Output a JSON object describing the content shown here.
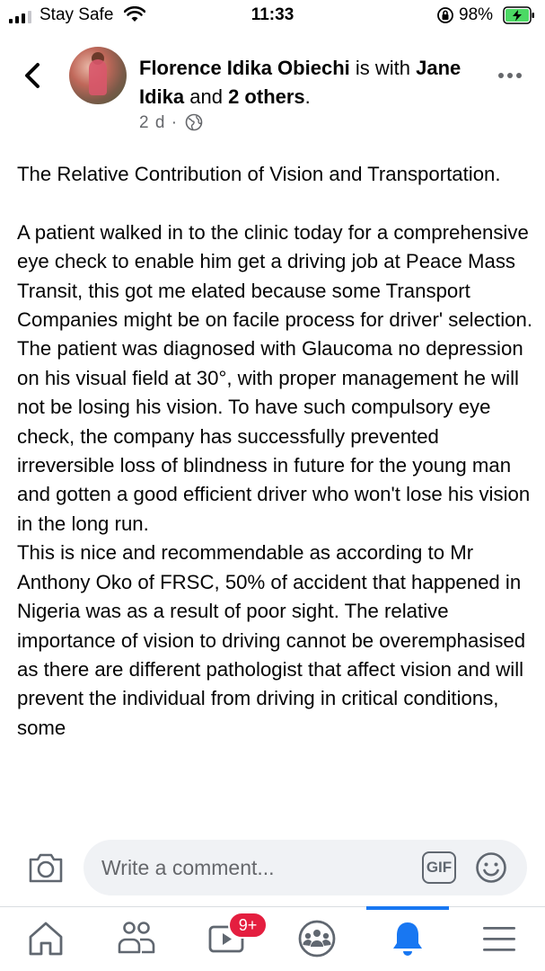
{
  "status_bar": {
    "carrier": "Stay Safe",
    "time": "11:33",
    "battery_percent": "98%"
  },
  "post": {
    "author": "Florence Idika Obiechi",
    "with_text": " is with ",
    "tagged_person": "Jane Idika",
    "and_text": " and ",
    "others": "2 others",
    "period": ".",
    "time_ago": "2 d",
    "separator": " · ",
    "audience_icon": "globe-icon",
    "body": "The Relative Contribution of Vision and Transportation.\n\nA patient walked in to the clinic today for a comprehensive eye check to enable him get a driving job at Peace Mass Transit, this got me elated because some Transport Companies might be on facile process for driver' selection. The patient was diagnosed with Glaucoma no depression on his visual field at 30°, with proper management he will not be losing his vision. To have such compulsory eye check, the company has successfully prevented irreversible loss of blindness in future for the young man and gotten a good efficient driver who won't lose his vision in the long run.\nThis is nice and recommendable as according to Mr Anthony Oko of  FRSC, 50% of accident that happened in Nigeria was as a result of poor sight. The relative importance of vision to driving cannot be overemphasised as there are different pathologist that affect vision and will prevent the individual from driving in critical conditions, some"
  },
  "comment": {
    "placeholder": "Write a comment...",
    "gif_label": "GIF"
  },
  "tabs": {
    "items": [
      {
        "name": "home",
        "icon": "home-icon"
      },
      {
        "name": "friends",
        "icon": "friends-icon"
      },
      {
        "name": "watch",
        "icon": "video-icon"
      },
      {
        "name": "groups",
        "icon": "groups-icon"
      },
      {
        "name": "notifications",
        "icon": "bell-icon",
        "active": true
      },
      {
        "name": "menu",
        "icon": "menu-icon"
      }
    ],
    "watch_badge": "9+"
  },
  "colors": {
    "accent": "#1877f2",
    "badge": "#e41e3f",
    "battery": "#4cd964",
    "secondary_text": "#65676b"
  }
}
